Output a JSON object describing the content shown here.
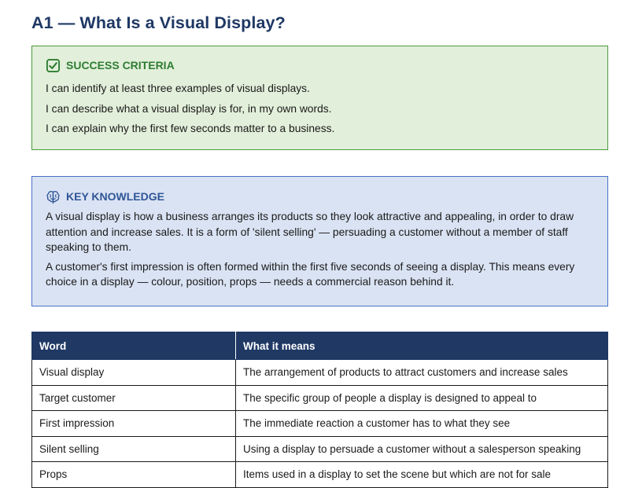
{
  "page_title": "A1 — What Is a Visual Display?",
  "success_criteria": {
    "heading": "SUCCESS CRITERIA",
    "icon": "checkbox-icon",
    "items": [
      "I can identify at least three examples of visual displays.",
      "I can describe what a visual display is for, in my own words.",
      "I can explain why the first few seconds matter to a business."
    ]
  },
  "key_knowledge": {
    "heading": "KEY KNOWLEDGE",
    "icon": "brain-icon",
    "paragraphs": [
      "A visual display is how a business arranges its products so they look attractive and appealing, in order to draw attention and increase sales. It is a form of 'silent selling' — persuading a customer without a member of staff speaking to them.",
      "A customer's first impression is often formed within the first five seconds of seeing a display. This means every choice in a display — colour, position, props — needs a commercial reason behind it."
    ]
  },
  "glossary": {
    "headers": [
      "Word",
      "What it means"
    ],
    "rows": [
      [
        "Visual display",
        "The arrangement of products to attract customers and increase sales"
      ],
      [
        "Target customer",
        "The specific group of people a display is designed to appeal to"
      ],
      [
        "First impression",
        "The immediate reaction a customer has to what they see"
      ],
      [
        "Silent selling",
        "Using a display to persuade a customer without a salesperson speaking"
      ],
      [
        "Props",
        "Items used in a display to set the scene but which are not for sale"
      ]
    ]
  },
  "colors": {
    "title": "#1f3864",
    "success_bg": "#e2efda",
    "success_border": "#4a9a3e",
    "knowledge_bg": "#dae3f3",
    "knowledge_border": "#4472c4",
    "table_header": "#1f3864"
  }
}
